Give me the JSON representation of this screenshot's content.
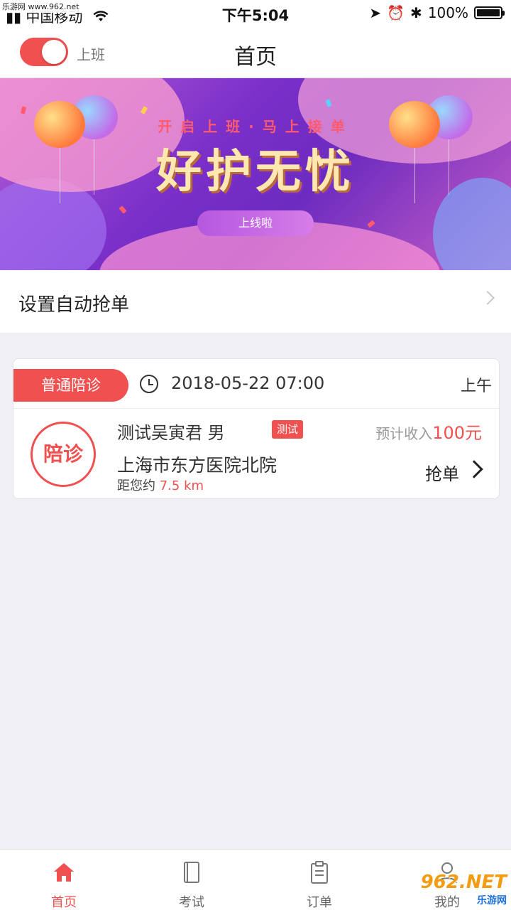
{
  "watermark_top": "乐游网 www.962.net",
  "status_bar": {
    "carrier": "中国移动",
    "time": "下午5:04",
    "battery": "100%"
  },
  "nav": {
    "toggle_label": "上班",
    "title": "首页"
  },
  "banner": {
    "subtitle": "开启上班·马上接单",
    "title": "好护无忧",
    "pill": "上线啦"
  },
  "auto_grab": {
    "label": "设置自动抢单"
  },
  "order": {
    "type": "普通陪诊",
    "datetime": "2018-05-22 07:00",
    "period": "上午",
    "badge": "陪诊",
    "patient": "测试吴寅君  男",
    "tag": "测试",
    "income_label": "预计收入",
    "income_amount": "100元",
    "hospital": "上海市东方医院北院",
    "distance_label": "距您约",
    "distance_value": "7.5 km",
    "grab_label": "抢单"
  },
  "tabbar": [
    {
      "label": "首页",
      "icon": "home-icon",
      "active": true
    },
    {
      "label": "考试",
      "icon": "book-icon",
      "active": false
    },
    {
      "label": "订单",
      "icon": "clipboard-icon",
      "active": false
    },
    {
      "label": "我的",
      "icon": "user-icon",
      "active": false
    }
  ],
  "watermark_bottom": {
    "big": "962.NET",
    "small": "乐游网"
  },
  "colors": {
    "accent": "#f0504f",
    "background": "#efeff4"
  }
}
